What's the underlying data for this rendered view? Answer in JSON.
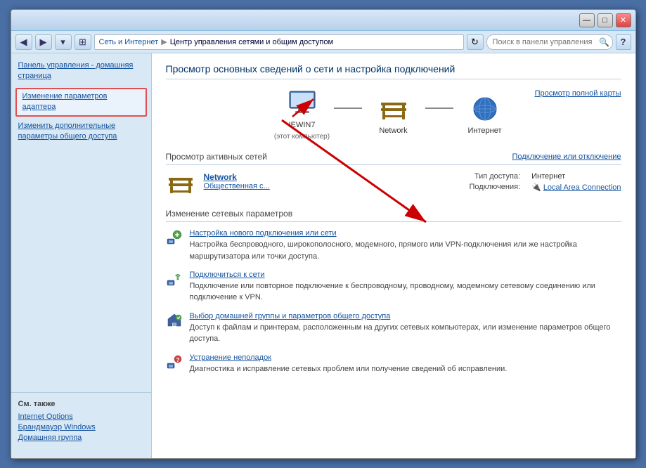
{
  "window": {
    "title": "Центр управления сетями и общим доступом",
    "controls": {
      "minimize": "—",
      "maximize": "□",
      "close": "✕"
    }
  },
  "addressbar": {
    "back": "◀",
    "forward": "▶",
    "dropdown": "▾",
    "breadcrumb_root_icon": "⊞",
    "breadcrumb": [
      "Сеть и Интернет",
      "Центр управления сетями и общим доступом"
    ],
    "refresh": "↻",
    "search_placeholder": "Поиск в панели управления",
    "search_icon": "🔍"
  },
  "help_btn": "?",
  "sidebar": {
    "title": "Панель управления - домашняя страница",
    "items": [
      {
        "label": "Изменение параметров адаптера",
        "active": true
      },
      {
        "label": "Изменить дополнительные параметры общего доступа",
        "active": false
      }
    ],
    "also_section": {
      "title": "См. также",
      "links": [
        "Internet Options",
        "Брандмауэр Windows",
        "Домашняя группа"
      ]
    }
  },
  "main": {
    "title": "Просмотр основных сведений о сети и настройка подключений",
    "view_full_map": "Просмотр полной карты",
    "network_nodes": [
      {
        "label": "IEWIN7",
        "sublabel": "(этот компьютер)",
        "type": "computer"
      },
      {
        "label": "Network",
        "sublabel": "",
        "type": "bench"
      },
      {
        "label": "Интернет",
        "sublabel": "",
        "type": "internet"
      }
    ],
    "active_networks_title": "Просмотр активных сетей",
    "connect_disconnect": "Подключение или отключение",
    "network": {
      "name": "Network",
      "type": "Общественная с...",
      "access_type_label": "Тип доступа:",
      "access_type_value": "Интернет",
      "connections_label": "Подключения:",
      "connections_value": "Local Area Connection"
    },
    "change_settings_title": "Изменение сетевых параметров",
    "settings_items": [
      {
        "link": "Настройка нового подключения или сети",
        "desc": "Настройка беспроводного, широкополосного, модемного, прямого или VPN-подключения или же настройка маршрутизатора или точки доступа."
      },
      {
        "link": "Подключиться к сети",
        "desc": "Подключение или повторное подключение к беспроводному, проводному, модемному сетевому соединению или подключение к VPN."
      },
      {
        "link": "Выбор домашней группы и параметров общего доступа",
        "desc": "Доступ к файлам и принтерам, расположенным на других сетевых компьютерах, или изменение параметров общего доступа."
      },
      {
        "link": "Устранение неполадок",
        "desc": "Диагностика и исправление сетевых проблем или получение сведений об исправлении."
      }
    ]
  }
}
